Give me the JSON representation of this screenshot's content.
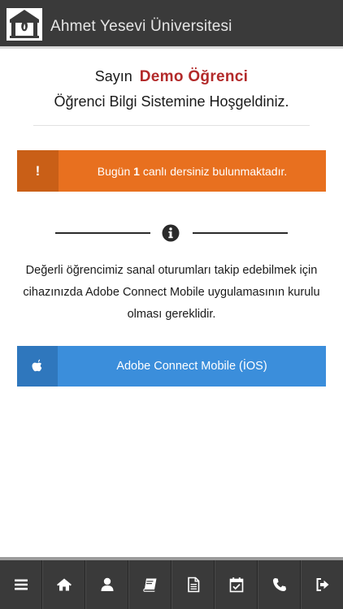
{
  "header": {
    "title": "Ahmet Yesevi Üniversitesi",
    "logo_icon": "university-logo-icon"
  },
  "welcome": {
    "salutation": "Sayın",
    "student_name": "Demo Öğrenci",
    "message": "Öğrenci Bilgi Sistemine Hoşgeldiniz."
  },
  "alert": {
    "icon_glyph": "!",
    "text_before": "Bugün",
    "count": "1",
    "text_after": "canlı dersiniz bulunmaktadır.",
    "color": "#e8701f"
  },
  "info": {
    "icon": "info-circle-icon",
    "text": "Değerli öğrencimiz sanal oturumları takip edebilmek için cihazınızda Adobe Connect Mobile uygulamasının kurulu olması gereklidir."
  },
  "app_button": {
    "label": "Adobe Connect Mobile (İOS)",
    "icon": "apple-icon",
    "color": "#3b8edb"
  },
  "bottom_nav": [
    {
      "name": "menu",
      "icon": "menu-icon"
    },
    {
      "name": "home",
      "icon": "home-icon"
    },
    {
      "name": "profile",
      "icon": "user-icon"
    },
    {
      "name": "courses",
      "icon": "book-icon"
    },
    {
      "name": "documents",
      "icon": "document-icon"
    },
    {
      "name": "calendar",
      "icon": "calendar-check-icon"
    },
    {
      "name": "contact",
      "icon": "phone-icon"
    },
    {
      "name": "logout",
      "icon": "sign-out-icon"
    }
  ]
}
